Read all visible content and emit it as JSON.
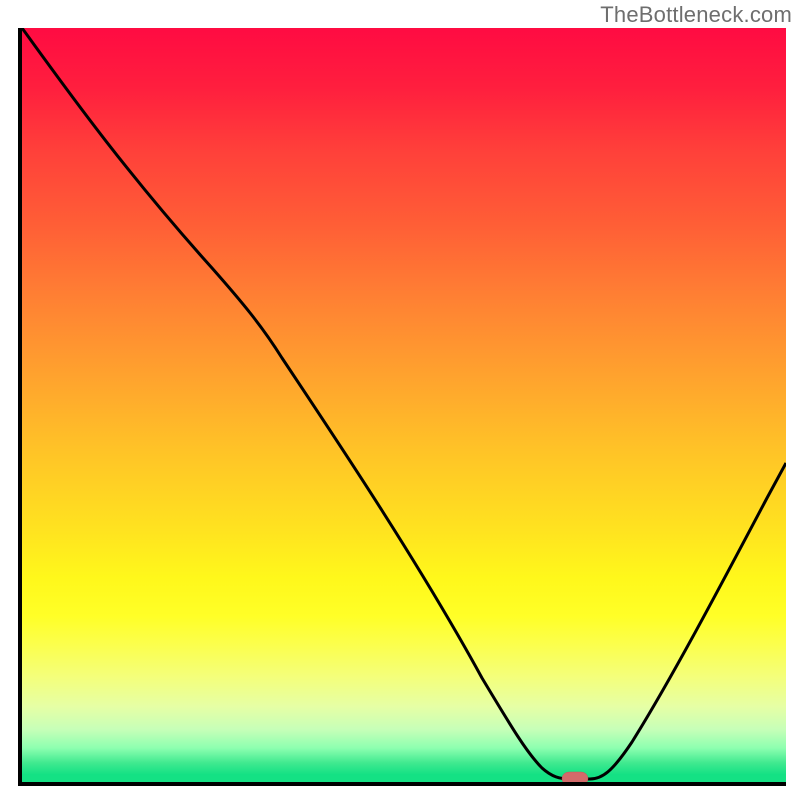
{
  "watermark": "TheBottleneck.com",
  "chart_data": {
    "type": "line",
    "title": "",
    "xlabel": "",
    "ylabel": "",
    "xlim": [
      0,
      100
    ],
    "ylim": [
      0,
      100
    ],
    "grid": false,
    "series": [
      {
        "name": "bottleneck-curve",
        "x": [
          0,
          8,
          18,
          28,
          33,
          40,
          48,
          56,
          62,
          66,
          70,
          72,
          74,
          80,
          86,
          92,
          99
        ],
        "values": [
          100,
          88,
          74,
          60,
          53,
          44,
          34,
          24,
          15,
          8,
          2,
          1,
          1,
          8,
          20,
          34,
          50
        ]
      }
    ],
    "annotations": [
      {
        "name": "min-marker",
        "x": 72,
        "y": 1
      }
    ],
    "background_gradient": {
      "direction": "vertical",
      "stops": [
        {
          "pos": 0.0,
          "color": "#ff0b42"
        },
        {
          "pos": 0.4,
          "color": "#ff8133"
        },
        {
          "pos": 0.7,
          "color": "#ffe120"
        },
        {
          "pos": 0.9,
          "color": "#e6ffa5"
        },
        {
          "pos": 1.0,
          "color": "#14e184"
        }
      ]
    }
  }
}
